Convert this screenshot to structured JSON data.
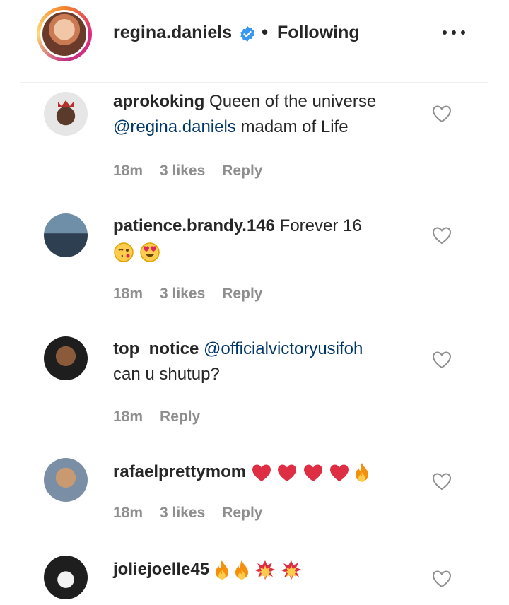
{
  "header": {
    "username": "regina.daniels",
    "separator": "•",
    "status": "Following"
  },
  "comments": [
    {
      "username": "aprokoking",
      "text_before": "Queen of the universe",
      "mention": "@regina.daniels",
      "text_after": "madam of Life",
      "time": "18m",
      "likes": "3 likes",
      "reply": "Reply"
    },
    {
      "username": "patience.brandy.146",
      "text": "Forever 16",
      "emojis": [
        "winking-kiss-emoji",
        "heart-eyes-emoji"
      ],
      "time": "18m",
      "likes": "3 likes",
      "reply": "Reply"
    },
    {
      "username": "top_notice",
      "mention": "@officialvictoryusifoh",
      "text_after": "can u shutup?",
      "time": "18m",
      "reply": "Reply"
    },
    {
      "username": "rafaelprettymom",
      "emojis": [
        "red-heart-emoji",
        "red-heart-emoji",
        "red-heart-emoji",
        "red-heart-emoji",
        "fire-emoji"
      ],
      "time": "18m",
      "likes": "3 likes",
      "reply": "Reply"
    },
    {
      "username": "joliejoelle45",
      "emojis": [
        "fire-emoji",
        "fire-emoji",
        "collision-emoji",
        "collision-emoji"
      ]
    }
  ],
  "colors": {
    "text": "#262626",
    "mention": "#00376b",
    "meta": "#8e8e8e",
    "verified": "#3897f0"
  }
}
